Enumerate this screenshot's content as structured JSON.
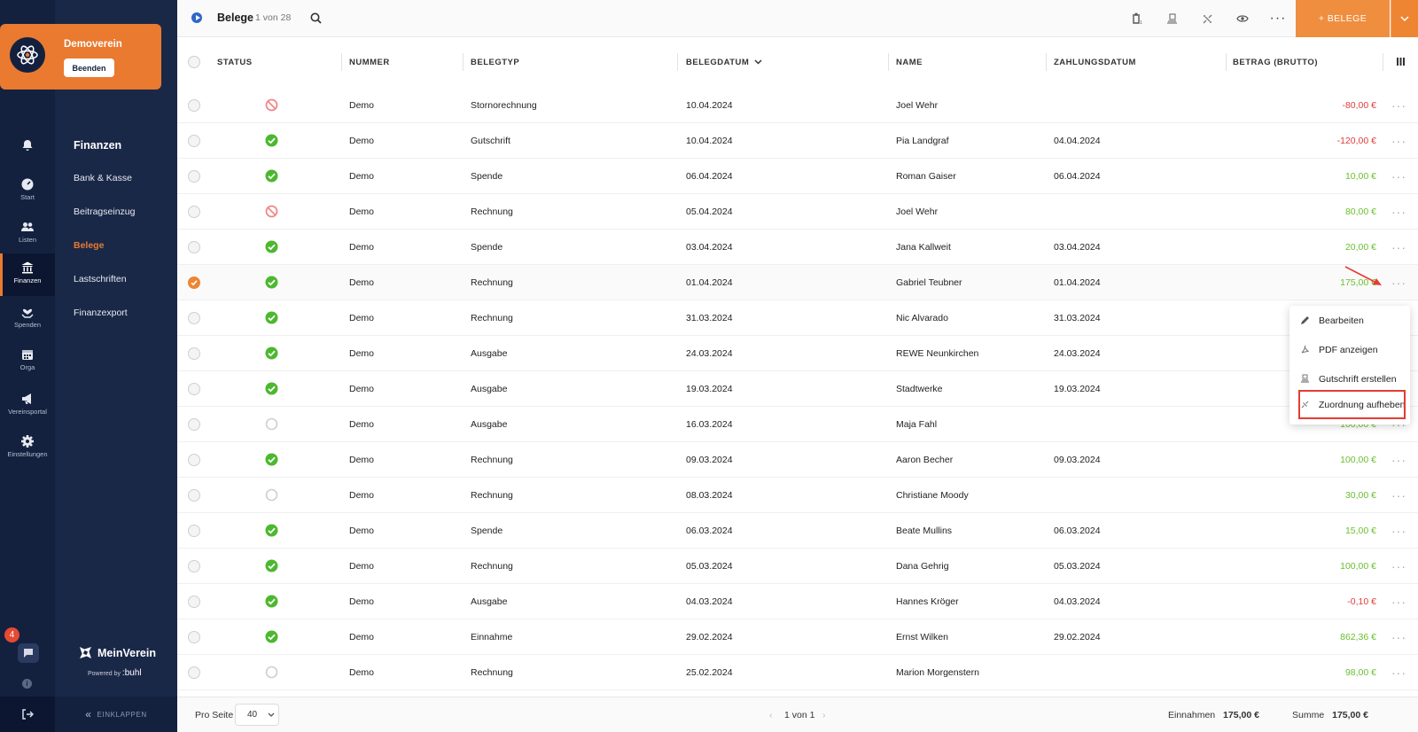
{
  "app": {
    "club_name": "Demoverein",
    "club_button": "Beenden",
    "brand": "MeinVerein",
    "powered_by": "Powered by",
    "powered_brand": ":buhl",
    "collapse_label": "EINKLAPPEN",
    "chat_badge": "4"
  },
  "rail": {
    "items": [
      {
        "label": "",
        "icon": "bell-icon"
      },
      {
        "label": "Start",
        "icon": "dashboard-icon"
      },
      {
        "label": "Listen",
        "icon": "users-icon"
      },
      {
        "label": "Finanzen",
        "icon": "bank-icon"
      },
      {
        "label": "Spenden",
        "icon": "donation-icon"
      },
      {
        "label": "Orga",
        "icon": "calendar-icon"
      },
      {
        "label": "Vereinsportal",
        "icon": "megaphone-icon"
      },
      {
        "label": "Einstellungen",
        "icon": "gear-icon"
      }
    ]
  },
  "subnav": {
    "title": "Finanzen",
    "items": [
      "Bank & Kasse",
      "Beitragseinzug",
      "Belege",
      "Lastschriften",
      "Finanzexport"
    ],
    "active": "Belege"
  },
  "header": {
    "title": "Belege",
    "count": "1 von 28",
    "add_button": "+ BELEGE"
  },
  "table": {
    "columns": [
      "STATUS",
      "NUMMER",
      "BELEGTYP",
      "BELEGDATUM",
      "NAME",
      "ZAHLUNGSDATUM",
      "BETRAG (BRUTTO)"
    ],
    "rows": [
      {
        "status": "cancelled",
        "nummer": "Demo",
        "typ": "Stornorechnung",
        "datum": "10.04.2024",
        "name": "Joel Wehr",
        "zahlung": "",
        "betrag": "-80,00 €",
        "neg": true
      },
      {
        "status": "ok",
        "nummer": "Demo",
        "typ": "Gutschrift",
        "datum": "10.04.2024",
        "name": "Pia Landgraf",
        "zahlung": "04.04.2024",
        "betrag": "-120,00 €",
        "neg": true
      },
      {
        "status": "ok",
        "nummer": "Demo",
        "typ": "Spende",
        "datum": "06.04.2024",
        "name": "Roman Gaiser",
        "zahlung": "06.04.2024",
        "betrag": "10,00 €",
        "neg": false
      },
      {
        "status": "cancelled",
        "nummer": "Demo",
        "typ": "Rechnung",
        "datum": "05.04.2024",
        "name": "Joel Wehr",
        "zahlung": "",
        "betrag": "80,00 €",
        "neg": false
      },
      {
        "status": "ok",
        "nummer": "Demo",
        "typ": "Spende",
        "datum": "03.04.2024",
        "name": "Jana Kallweit",
        "zahlung": "03.04.2024",
        "betrag": "20,00 €",
        "neg": false
      },
      {
        "status": "ok",
        "nummer": "Demo",
        "typ": "Rechnung",
        "datum": "01.04.2024",
        "name": "Gabriel Teubner",
        "zahlung": "01.04.2024",
        "betrag": "175,00 €",
        "neg": false,
        "selected": true
      },
      {
        "status": "ok",
        "nummer": "Demo",
        "typ": "Rechnung",
        "datum": "31.03.2024",
        "name": "Nic Alvarado",
        "zahlung": "31.03.2024",
        "betrag": "",
        "neg": false
      },
      {
        "status": "ok",
        "nummer": "Demo",
        "typ": "Ausgabe",
        "datum": "24.03.2024",
        "name": "REWE Neunkirchen",
        "zahlung": "24.03.2024",
        "betrag": "",
        "neg": false
      },
      {
        "status": "ok",
        "nummer": "Demo",
        "typ": "Ausgabe",
        "datum": "19.03.2024",
        "name": "Stadtwerke",
        "zahlung": "19.03.2024",
        "betrag": "",
        "neg": false
      },
      {
        "status": "open",
        "nummer": "Demo",
        "typ": "Ausgabe",
        "datum": "16.03.2024",
        "name": "Maja Fahl",
        "zahlung": "",
        "betrag": "100,00 €",
        "neg": false
      },
      {
        "status": "ok",
        "nummer": "Demo",
        "typ": "Rechnung",
        "datum": "09.03.2024",
        "name": "Aaron Becher",
        "zahlung": "09.03.2024",
        "betrag": "100,00 €",
        "neg": false
      },
      {
        "status": "open",
        "nummer": "Demo",
        "typ": "Rechnung",
        "datum": "08.03.2024",
        "name": "Christiane Moody",
        "zahlung": "",
        "betrag": "30,00 €",
        "neg": false
      },
      {
        "status": "ok",
        "nummer": "Demo",
        "typ": "Spende",
        "datum": "06.03.2024",
        "name": "Beate Mullins",
        "zahlung": "06.03.2024",
        "betrag": "15,00 €",
        "neg": false
      },
      {
        "status": "ok",
        "nummer": "Demo",
        "typ": "Rechnung",
        "datum": "05.03.2024",
        "name": "Dana Gehrig",
        "zahlung": "05.03.2024",
        "betrag": "100,00 €",
        "neg": false
      },
      {
        "status": "ok",
        "nummer": "Demo",
        "typ": "Ausgabe",
        "datum": "04.03.2024",
        "name": "Hannes Kröger",
        "zahlung": "04.03.2024",
        "betrag": "-0,10 €",
        "neg": true
      },
      {
        "status": "ok",
        "nummer": "Demo",
        "typ": "Einnahme",
        "datum": "29.02.2024",
        "name": "Ernst Wilken",
        "zahlung": "29.02.2024",
        "betrag": "862,36 €",
        "neg": false
      },
      {
        "status": "open",
        "nummer": "Demo",
        "typ": "Rechnung",
        "datum": "25.02.2024",
        "name": "Marion Morgenstern",
        "zahlung": "",
        "betrag": "98,00 €",
        "neg": false
      }
    ]
  },
  "context_menu": {
    "items": [
      {
        "label": "Bearbeiten",
        "icon": "pencil-icon"
      },
      {
        "label": "PDF anzeigen",
        "icon": "pdf-icon"
      },
      {
        "label": "Gutschrift erstellen",
        "icon": "credit-note-icon"
      },
      {
        "label": "Zuordnung aufheben",
        "icon": "unlink-icon",
        "highlighted": true
      }
    ]
  },
  "footer": {
    "per_page_label": "Pro Seite",
    "per_page_value": "40",
    "pagination": "1 von 1",
    "income_label": "Einnahmen",
    "income_value": "175,00 €",
    "sum_label": "Summe",
    "sum_value": "175,00 €"
  },
  "colors": {
    "accent": "#ee8533",
    "sidebar": "#13213f",
    "positive": "#6abf2e",
    "negative": "#e23b3b",
    "highlight": "#e43c32"
  }
}
